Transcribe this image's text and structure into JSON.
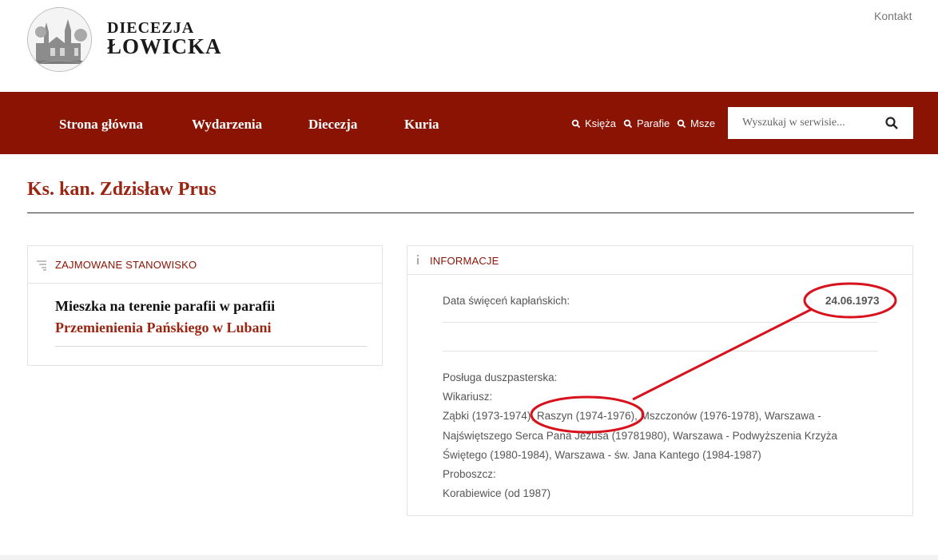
{
  "header": {
    "logo_line1": "Diecezja",
    "logo_line2": "Łowicka",
    "contact_link": "Kontakt"
  },
  "nav": {
    "items": [
      {
        "label": "Strona główna"
      },
      {
        "label": "Wydarzenia"
      },
      {
        "label": "Diecezja"
      },
      {
        "label": "Kuria"
      }
    ],
    "quick_links": [
      {
        "label": "Księża",
        "icon": "search-icon"
      },
      {
        "label": "Parafie",
        "icon": "search-icon"
      },
      {
        "label": "Msze",
        "icon": "search-icon"
      }
    ],
    "search": {
      "placeholder": "Wyszukaj w serwisie...",
      "value": "",
      "icon": "search-icon"
    }
  },
  "page": {
    "title": "Ks. kan. Zdzisław Prus"
  },
  "position_panel": {
    "heading": "ZAJMOWANE STANOWISKO",
    "icon": "list-icon",
    "text_line1": "Mieszka na terenie parafii w parafii",
    "text_line2": "Przemienienia Pańskiego w Lubani"
  },
  "info_panel": {
    "heading": "INFORMACJE",
    "icon": "info-icon",
    "ordination_label": "Data święceń kapłańskich:",
    "ordination_date": "24.06.1973",
    "ministry_lines": [
      "Posługa duszpasterska:",
      "Wikariusz:",
      "Ząbki (1973-1974), Raszyn (1974-1976), Mszczonów (1976-1978), Warszawa -",
      "Najświętszego Serca Pana Jezusa (19781980), Warszawa - Podwyższenia Krzyża",
      "Świętego (1980-1984), Warszawa - św. Jana Kantego (1984-1987)",
      "Proboszcz:",
      "Korabiewice (od 1987)"
    ]
  },
  "colors": {
    "brand_red": "#8b1304",
    "title_red": "#9a2512",
    "annotation_red": "#d8121c"
  }
}
